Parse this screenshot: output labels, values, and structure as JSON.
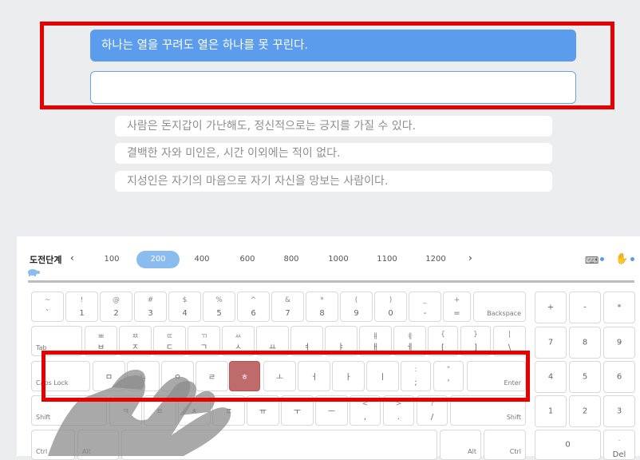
{
  "practice": {
    "target_sentence": "하나는 열을 꾸려도 열은 하나를 못 꾸린다.",
    "input_value": "",
    "next_lines": [
      "사람은 돈지갑이 가난해도, 정신적으로는 긍지를 가질 수 있다.",
      "결백한 자와 미인은, 시간 이외에는 적이 없다.",
      "지성인은 자기의 마음으로 자기 자신을 망보는 사람이다."
    ]
  },
  "stage": {
    "title": "도전단계",
    "prev_icon": "‹",
    "next_icon": "›",
    "levels": [
      "100",
      "200",
      "400",
      "600",
      "800",
      "1000",
      "1100",
      "1200"
    ],
    "active_level": "200"
  },
  "icons": {
    "turtle": "turtle-icon",
    "keyboard": "keyboard-icon",
    "hand": "hand-icon"
  },
  "keyboard": {
    "row1": [
      {
        "t": "~",
        "b": "`"
      },
      {
        "t": "!",
        "b": "1"
      },
      {
        "t": "@",
        "b": "2"
      },
      {
        "t": "#",
        "b": "3"
      },
      {
        "t": "$",
        "b": "4"
      },
      {
        "t": "%",
        "b": "5"
      },
      {
        "t": "^",
        "b": "6"
      },
      {
        "t": "&",
        "b": "7"
      },
      {
        "t": "*",
        "b": "8"
      },
      {
        "t": "(",
        "b": "9"
      },
      {
        "t": ")",
        "b": "0"
      },
      {
        "t": "_",
        "b": "-"
      },
      {
        "t": "+",
        "b": "="
      }
    ],
    "backspace": "Backspace",
    "tab": "Tab",
    "row2": [
      {
        "t": "ㅃ",
        "b": "ㅂ"
      },
      {
        "t": "ㅉ",
        "b": "ㅈ"
      },
      {
        "t": "ㄸ",
        "b": "ㄷ"
      },
      {
        "t": "ㄲ",
        "b": "ㄱ"
      },
      {
        "t": "ㅆ",
        "b": "ㅅ"
      },
      {
        "t": "",
        "b": "ㅛ"
      },
      {
        "t": "",
        "b": "ㅕ"
      },
      {
        "t": "",
        "b": "ㅑ"
      },
      {
        "t": "ㅒ",
        "b": "ㅐ"
      },
      {
        "t": "ㅖ",
        "b": "ㅔ"
      },
      {
        "t": "{",
        "b": "["
      },
      {
        "t": "}",
        "b": "]"
      },
      {
        "t": "|",
        "b": "\\"
      }
    ],
    "caps": "Caps Lock",
    "row3": [
      "ㅁ",
      "ㄴ",
      "ㅇ",
      "ㄹ",
      "ㅎ",
      "ㅗ",
      "ㅓ",
      "ㅏ",
      "ㅣ"
    ],
    "row3_punct": [
      {
        "t": ":",
        "b": ";"
      },
      {
        "t": "\"",
        "b": "'"
      }
    ],
    "enter": "Enter",
    "shift_left": "Shift",
    "row4": [
      "ㅋ",
      "ㅌ",
      "ㅊ",
      "ㅍ",
      "ㅠ",
      "ㅜ",
      "ㅡ"
    ],
    "row4_punct": [
      {
        "t": "<",
        "b": ","
      },
      {
        "t": ">",
        "b": "."
      },
      {
        "t": "?",
        "b": "/"
      }
    ],
    "shift_right": "Shift",
    "ctrl_left": "Ctrl",
    "alt_left": "Alt",
    "alt_right": "Alt",
    "ctrl_right": "Ctrl",
    "highlighted_key": "ㅎ"
  },
  "numpad": {
    "row1": [
      "+",
      "-",
      "*"
    ],
    "row2": [
      "7",
      "8",
      "9"
    ],
    "row3": [
      "4",
      "5",
      "6"
    ],
    "row4": [
      "1",
      "2",
      "3"
    ],
    "zero": "0",
    "del_top": ".",
    "del_label": "Del"
  },
  "colors": {
    "accent": "#5b9cec",
    "highlight_key": "#c06b6b",
    "annotation_red": "#e60000"
  }
}
